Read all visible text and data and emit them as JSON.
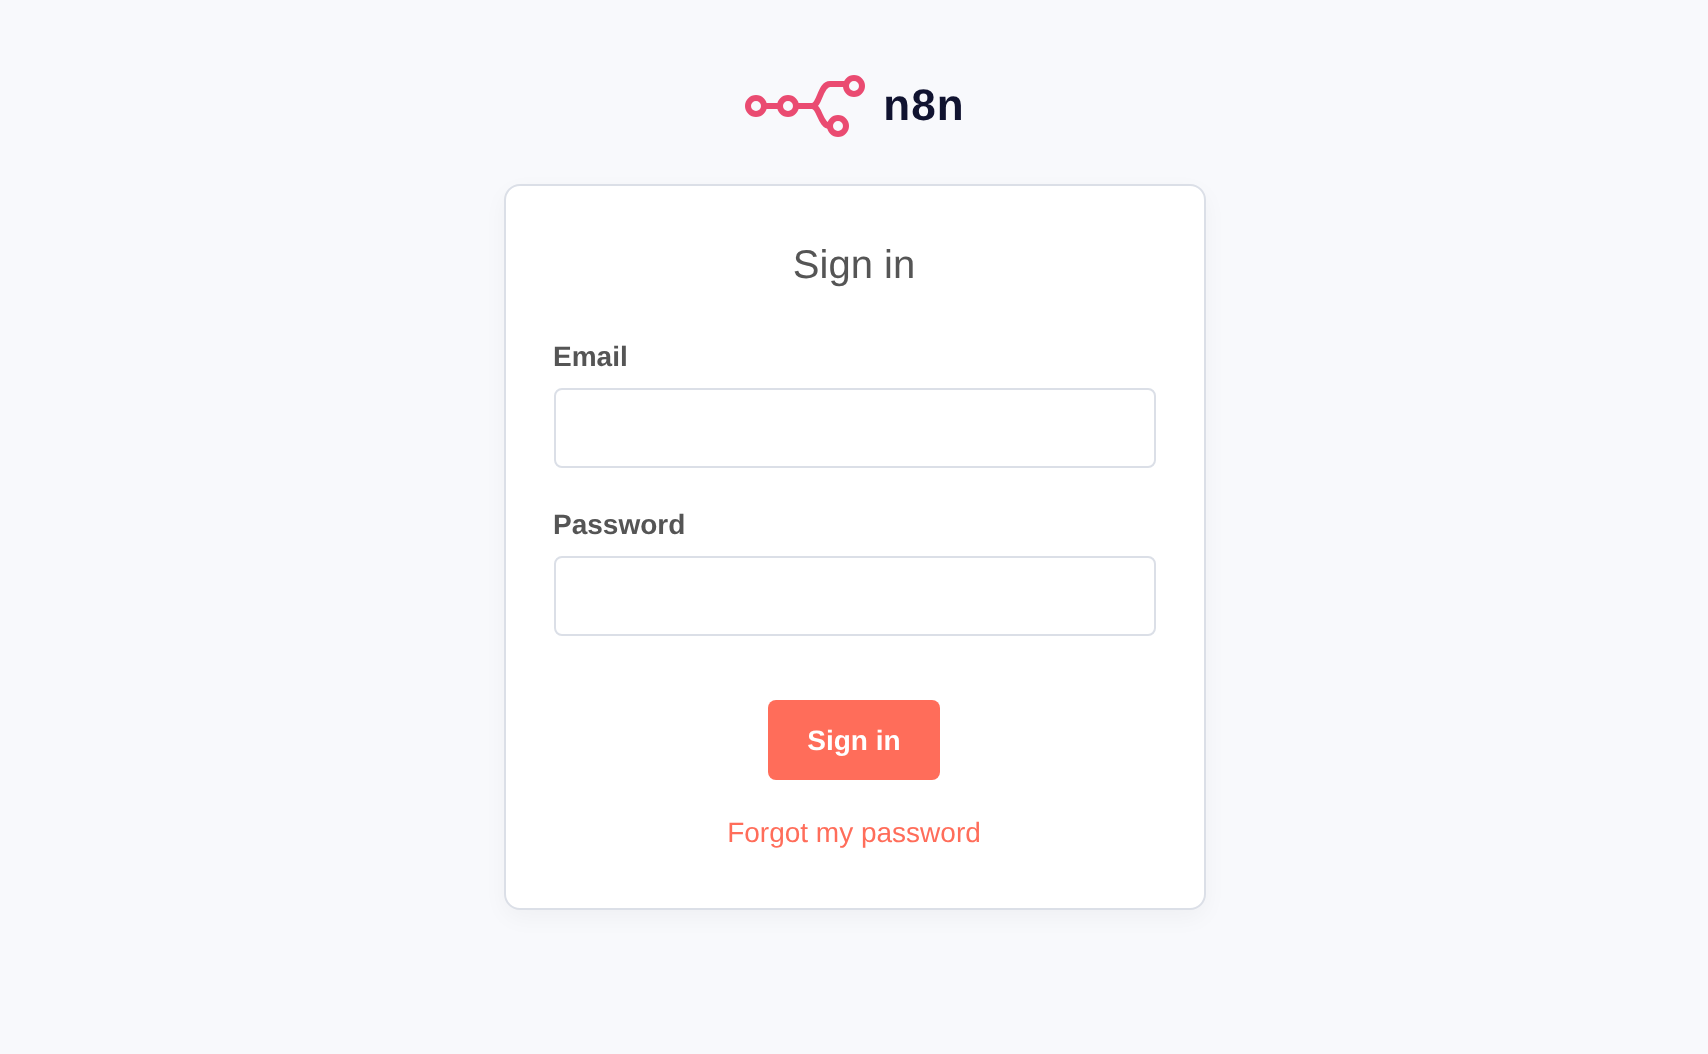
{
  "logo": {
    "text": "n8n"
  },
  "form": {
    "title": "Sign in",
    "fields": [
      {
        "label": "Email"
      },
      {
        "label": "Password"
      }
    ],
    "submit": "Sign in",
    "link": "Forgot my password"
  }
}
